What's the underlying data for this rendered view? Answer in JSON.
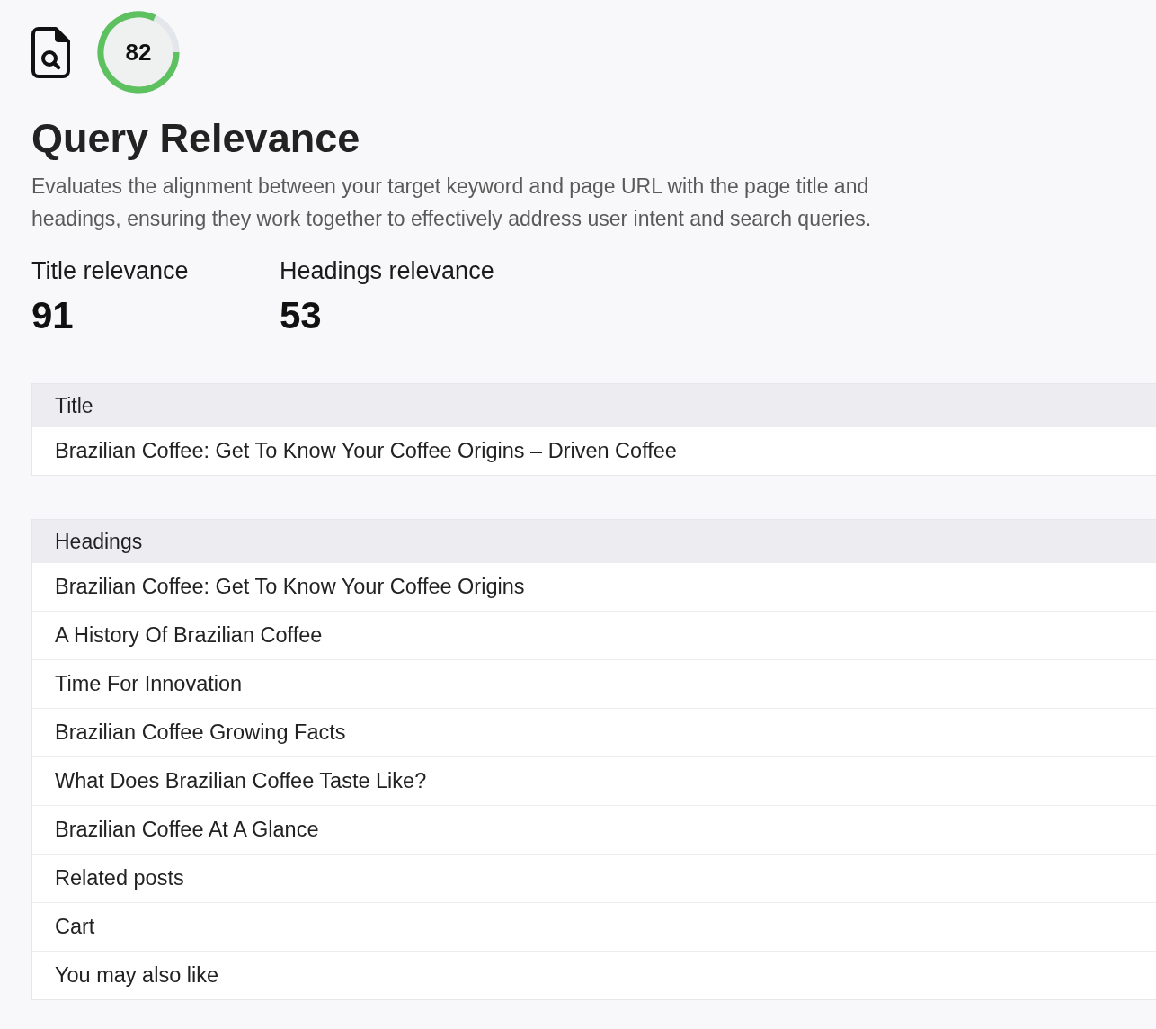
{
  "score": {
    "value": "82"
  },
  "title": "Query Relevance",
  "description": "Evaluates the alignment between your target keyword and page URL with the page title and headings, ensuring they work together to effectively address user intent and search queries.",
  "metrics": [
    {
      "label": "Title relevance",
      "value": "91"
    },
    {
      "label": "Headings relevance",
      "value": "53"
    }
  ],
  "tables": [
    {
      "heading": "Title",
      "rows": [
        "Brazilian Coffee: Get To Know Your Coffee Origins – Driven Coffee"
      ]
    },
    {
      "heading": "Headings",
      "rows": [
        "Brazilian Coffee: Get To Know Your Coffee Origins",
        "A History Of Brazilian Coffee",
        "Time For Innovation",
        "Brazilian Coffee Growing Facts",
        "What Does Brazilian Coffee Taste Like?",
        "Brazilian Coffee At A Glance",
        "Related posts",
        "Cart",
        "You may also like"
      ]
    }
  ]
}
